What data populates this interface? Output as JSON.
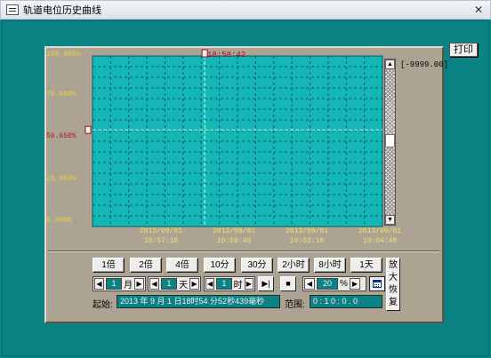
{
  "window": {
    "title": "轨道电位历史曲线",
    "close_symbol": "✕"
  },
  "print_label": "打印",
  "chart_data": {
    "type": "line",
    "series": [],
    "y_ticks": [
      "100.000%",
      "75.000%",
      "56.650%",
      "25.000%",
      "0.000%"
    ],
    "y_marker_value": "56.650%",
    "ylim": [
      0,
      100
    ],
    "x_ticks": [
      {
        "date": "2013/09/01",
        "time": "18:57:18"
      },
      {
        "date": "2013/09/01",
        "time": "18:59:48"
      },
      {
        "date": "2013/09/01",
        "time": "19:02:18"
      },
      {
        "date": "2013/09/01",
        "time": "19:04:48"
      }
    ],
    "cursor_time": "18:58:42",
    "min_value": "[-9999.00]",
    "grid": true,
    "colors": {
      "plot_bg": "#14b6b6",
      "grid": "#0d5e6e",
      "marker_line": "#c8ffff"
    }
  },
  "scroll": {
    "up_symbol": "▲",
    "down_symbol": "▼"
  },
  "zoom_buttons": [
    "1倍",
    "2倍",
    "4倍",
    "10分",
    "30分",
    "2小时",
    "8小时",
    "1天"
  ],
  "steppers": {
    "month": {
      "dec": "◀",
      "value": "1",
      "unit": "月",
      "inc": "▶"
    },
    "day": {
      "dec": "◀",
      "value": "1",
      "unit": "天",
      "inc": "▶"
    },
    "hour": {
      "dec": "◀",
      "value": "1",
      "unit": "时",
      "inc": "▶"
    }
  },
  "playback": {
    "step_label": "▶|",
    "stop_label": "■"
  },
  "speed": {
    "dec": "◀",
    "value": "20",
    "unit": "%",
    "inc": "▶"
  },
  "zoom_restore_label": "放大恢复",
  "start": {
    "label": "起始:",
    "value": "2013 年 9 月 1 日18时54 分52秒439毫秒"
  },
  "range": {
    "label": "范围:",
    "value": "0 : 1 0 : 0 . 0"
  },
  "icons": {
    "app": "window-app-icon",
    "calendar": "calendar-icon"
  }
}
